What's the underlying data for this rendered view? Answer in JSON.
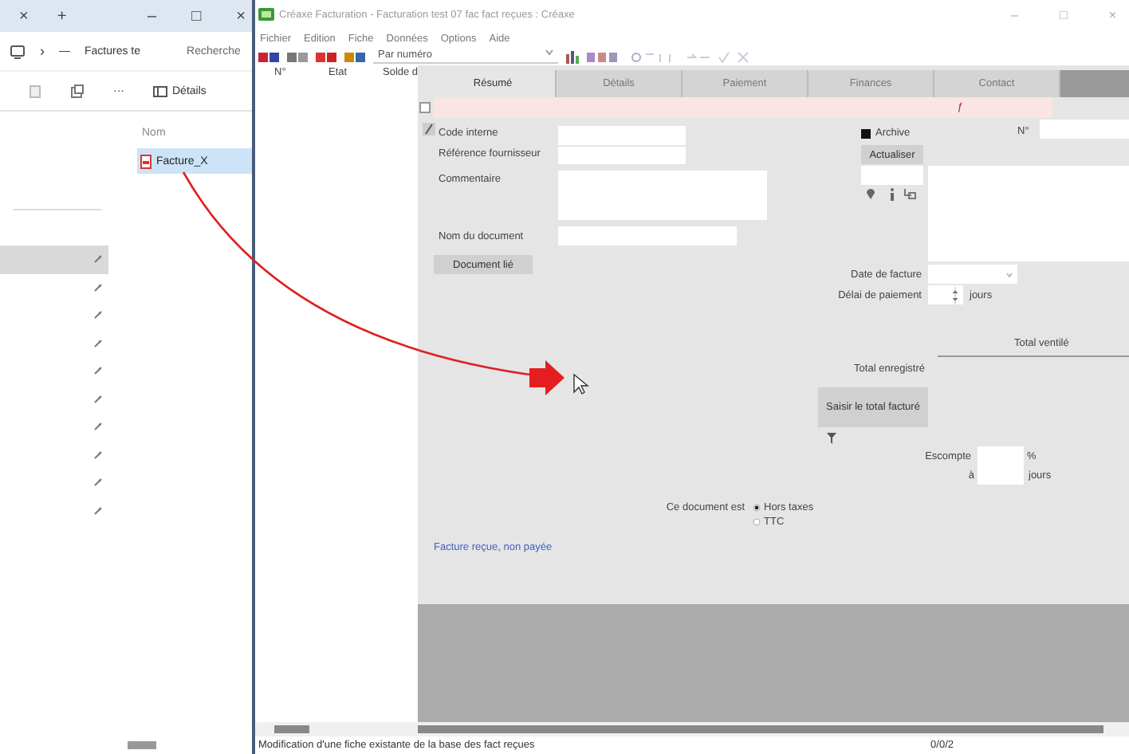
{
  "explorer": {
    "tab_close": "×",
    "new_tab": "+",
    "window_buttons": [
      "–",
      "□",
      "×"
    ],
    "path_separator": "›",
    "path_more": "—",
    "path_folder": "Factures te",
    "search_placeholder": "Recherche",
    "toolbar_more": "···",
    "view_button": "Détails",
    "column_header": "Nom",
    "nav_rows": [
      {
        "selected": true
      },
      {
        "selected": false
      },
      {
        "selected": false
      },
      {
        "selected": false
      },
      {
        "selected": false
      },
      {
        "selected": false
      },
      {
        "selected": false
      },
      {
        "selected": false
      },
      {
        "selected": false
      },
      {
        "selected": false
      }
    ],
    "files": [
      {
        "name": "Facture_X",
        "selected": true
      }
    ]
  },
  "app": {
    "title": "Créaxe Facturation - Facturation test 07 fac fact reçues : Créaxe",
    "window_buttons": [
      "–",
      "□",
      "×"
    ],
    "menu": [
      "Fichier",
      "Edition",
      "Fiche",
      "Données",
      "Options",
      "Aide"
    ],
    "sort_dropdown": "Par numéro",
    "list_columns": [
      "N°",
      "Etat",
      "Solde d"
    ],
    "tabs": [
      {
        "label": "Résumé",
        "selected": true
      },
      {
        "label": "Détails",
        "selected": false
      },
      {
        "label": "Paiement",
        "selected": false
      },
      {
        "label": "Finances",
        "selected": false
      },
      {
        "label": "Contact",
        "selected": false
      }
    ],
    "form": {
      "row_checkbox": {
        "checked": false
      },
      "flag": "ƒ",
      "code_label": "Code interne",
      "ref_label": "Référence fournisseur",
      "comment_label": "Commentaire",
      "docname_label": "Nom du document",
      "doc_button": "Document lié",
      "archive": {
        "label": "Archive",
        "checked": true
      },
      "number_label": "N°",
      "refresh_button": "Actualiser",
      "date_label": "Date de facture",
      "delay_label": "Délai de paiement",
      "delay_unit": "jours",
      "total_column": "Total ventilé",
      "total_label": "Total enregistré",
      "total_button": "Saisir le total facturé",
      "discount_label": "Escompte",
      "discount_unit": "%",
      "discount_at": "à",
      "discount_days": "jours",
      "vat_label": "Ce document est",
      "vat_options": [
        {
          "label": "Hors taxes",
          "selected": true
        },
        {
          "label": "TTC",
          "selected": false
        }
      ],
      "status_link": "Facture reçue, non payée"
    },
    "status_bar": {
      "message": "Modification d'une fiche existante de la base des fact reçues",
      "counter": "0/0/2"
    }
  }
}
